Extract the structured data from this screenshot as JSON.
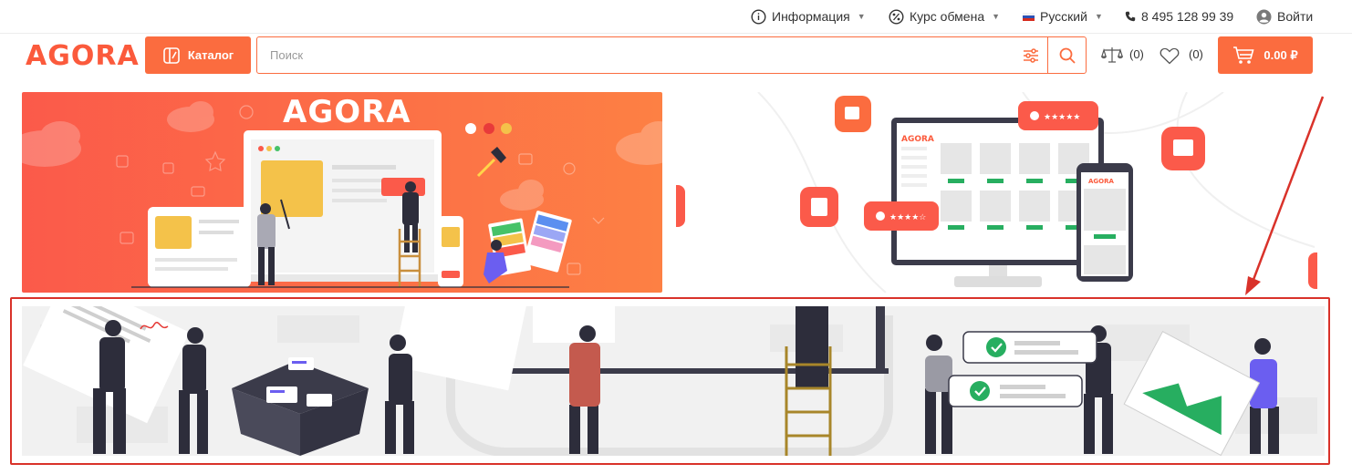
{
  "top_nav": {
    "info_label": "Информация",
    "exchange_label": "Курс обмена",
    "language_label": "Русский",
    "phone": "8 495 128 99 39",
    "login_label": "Войти"
  },
  "header": {
    "logo_text": "AGORA",
    "catalog_label": "Каталог",
    "search_placeholder": "Поиск",
    "compare_count": "(0)",
    "wishlist_count": "(0)",
    "cart_total": "0.00 ₽"
  },
  "banners": {
    "left_logo_text": "AGORA",
    "right_logo_text": "AGORA"
  },
  "colors": {
    "accent": "#fb6c3f",
    "highlight": "#d9322a",
    "success": "#27ae60"
  }
}
